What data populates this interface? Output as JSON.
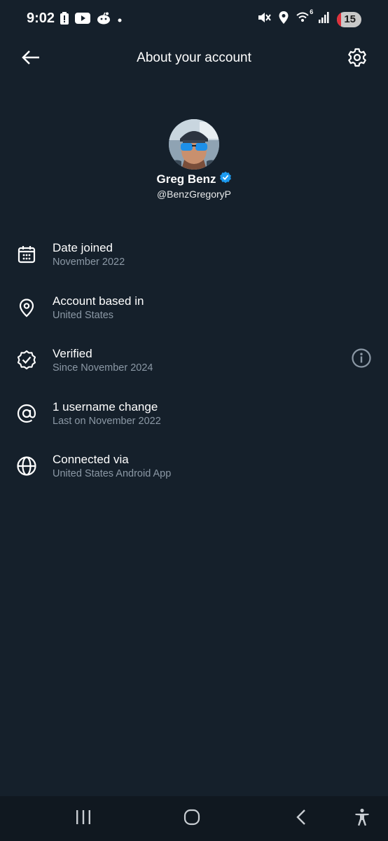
{
  "status_bar": {
    "time": "9:02",
    "left_icons": [
      "battery-alert-icon",
      "youtube-icon",
      "reddit-icon",
      "dot-icon"
    ],
    "right_icons": [
      "mute-icon",
      "location-icon",
      "wifi-icon",
      "signal-icon"
    ],
    "wifi_badge": "6",
    "battery_level": "15"
  },
  "header": {
    "title": "About your account",
    "back_icon": "arrow-left-icon",
    "settings_icon": "gear-icon"
  },
  "profile": {
    "name": "Greg Benz",
    "handle": "@BenzGregoryP",
    "verified_color": "#1d9bf0"
  },
  "info_items": [
    {
      "icon": "calendar-icon",
      "title": "Date joined",
      "subtitle": "November 2022"
    },
    {
      "icon": "location-pin-icon",
      "title": "Account based in",
      "subtitle": "United States"
    },
    {
      "icon": "verified-badge-icon",
      "title": "Verified",
      "subtitle": "Since November 2024",
      "action_icon": "info-icon"
    },
    {
      "icon": "at-sign-icon",
      "title": "1 username change",
      "subtitle": "Last on November 2022"
    },
    {
      "icon": "globe-icon",
      "title": "Connected via",
      "subtitle": "United States Android App"
    }
  ],
  "nav_bar": {
    "items": [
      "recent-apps-icon",
      "home-icon",
      "back-icon",
      "accessibility-icon"
    ]
  },
  "colors": {
    "background": "#15202b",
    "text_primary": "#e7e9ea",
    "text_secondary": "#8b98a5",
    "accent": "#1d9bf0"
  }
}
